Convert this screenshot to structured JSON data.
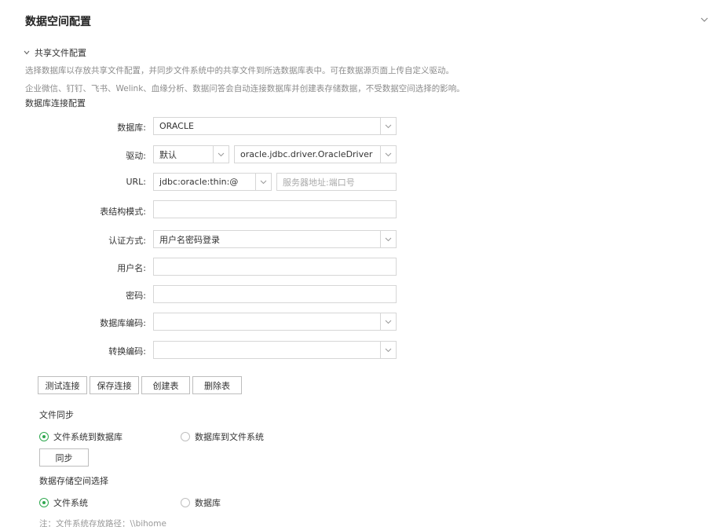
{
  "header": {
    "title": "数据空间配置",
    "collapse_icon": "chevron-down-icon"
  },
  "section": {
    "title": "共享文件配置",
    "desc1": "选择数据库以存放共享文件配置，并同步文件系统中的共享文件到所选数据库表中。可在数据源页面上传自定义驱动。",
    "desc2": "企业微信、钉钉、飞书、Welink、血缘分析、数据问答会自动连接数据库并创建表存储数据，不受数据空间选择的影响。",
    "subhead": "数据库连接配置"
  },
  "form": {
    "database_label": "数据库:",
    "database_value": "ORACLE",
    "driver_label": "驱动:",
    "driver_type": "默认",
    "driver_class": "oracle.jdbc.driver.OracleDriver",
    "url_label": "URL:",
    "url_prefix": "jdbc:oracle:thin:@",
    "url_placeholder": "服务器地址:端口号",
    "schema_label": "表结构模式:",
    "schema_value": "",
    "auth_label": "认证方式:",
    "auth_value": "用户名密码登录",
    "username_label": "用户名:",
    "username_value": "",
    "password_label": "密码:",
    "password_value": "",
    "db_encoding_label": "数据库编码:",
    "db_encoding_value": "",
    "convert_encoding_label": "转换编码:",
    "convert_encoding_value": ""
  },
  "buttons": {
    "test": "测试连接",
    "save": "保存连接",
    "create_table": "创建表",
    "delete_table": "删除表"
  },
  "sync": {
    "title": "文件同步",
    "option1": "文件系统到数据库",
    "option2": "数据库到文件系统",
    "selected": "option1",
    "sync_button": "同步"
  },
  "storage": {
    "title": "数据存储空间选择",
    "option1": "文件系统",
    "option2": "数据库",
    "selected": "option1",
    "note": "注：文件系统存放路径：\\\\bihome"
  },
  "colors": {
    "accent": "#2fa84f",
    "border": "#d6d6d6",
    "muted": "#8c8c8c"
  }
}
